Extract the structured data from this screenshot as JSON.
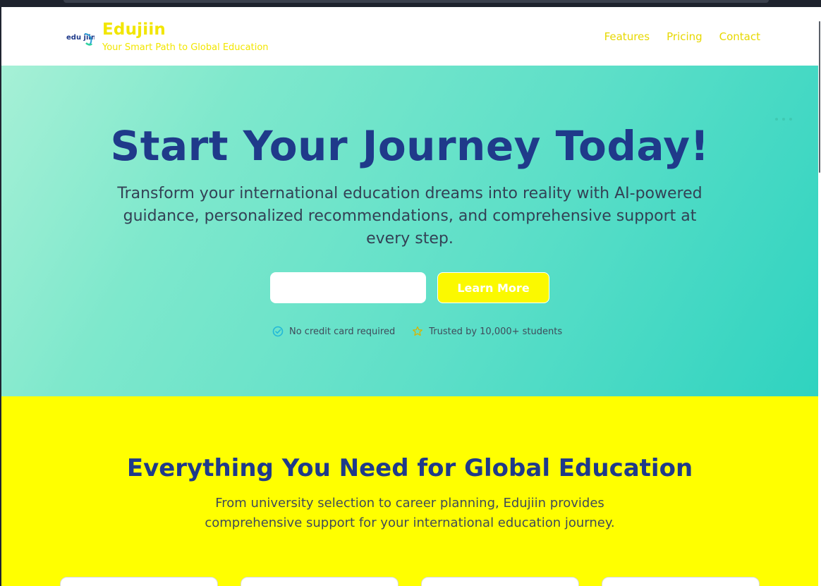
{
  "brand": {
    "logo_text": "edu jiin",
    "name": "Edujiin",
    "tagline": "Your Smart Path to Global Education"
  },
  "nav": {
    "items": [
      "Features",
      "Pricing",
      "Contact"
    ]
  },
  "hero": {
    "title": "Start Your Journey Today!",
    "subtitle": "Transform your international education dreams into reality with AI-powered guidance, personalized recommendations, and comprehensive support at every step.",
    "email_value": "",
    "email_placeholder": "",
    "cta_label": "Learn More",
    "trust": [
      {
        "icon": "check-circle-icon",
        "text": "No credit card required"
      },
      {
        "icon": "star-icon",
        "text": "Trusted by 10,000+ students"
      }
    ]
  },
  "features": {
    "title": "Everything You Need for Global Education",
    "subtitle": "From university selection to career planning, Edujiin provides comprehensive support for your international education journey."
  },
  "colors": {
    "brand_yellow": "#f2e600",
    "heading_blue": "#1f3a8a",
    "hero_gradient_start": "#a6f0d6",
    "hero_gradient_end": "#2fd3c0",
    "features_bg": "#ffff00"
  }
}
